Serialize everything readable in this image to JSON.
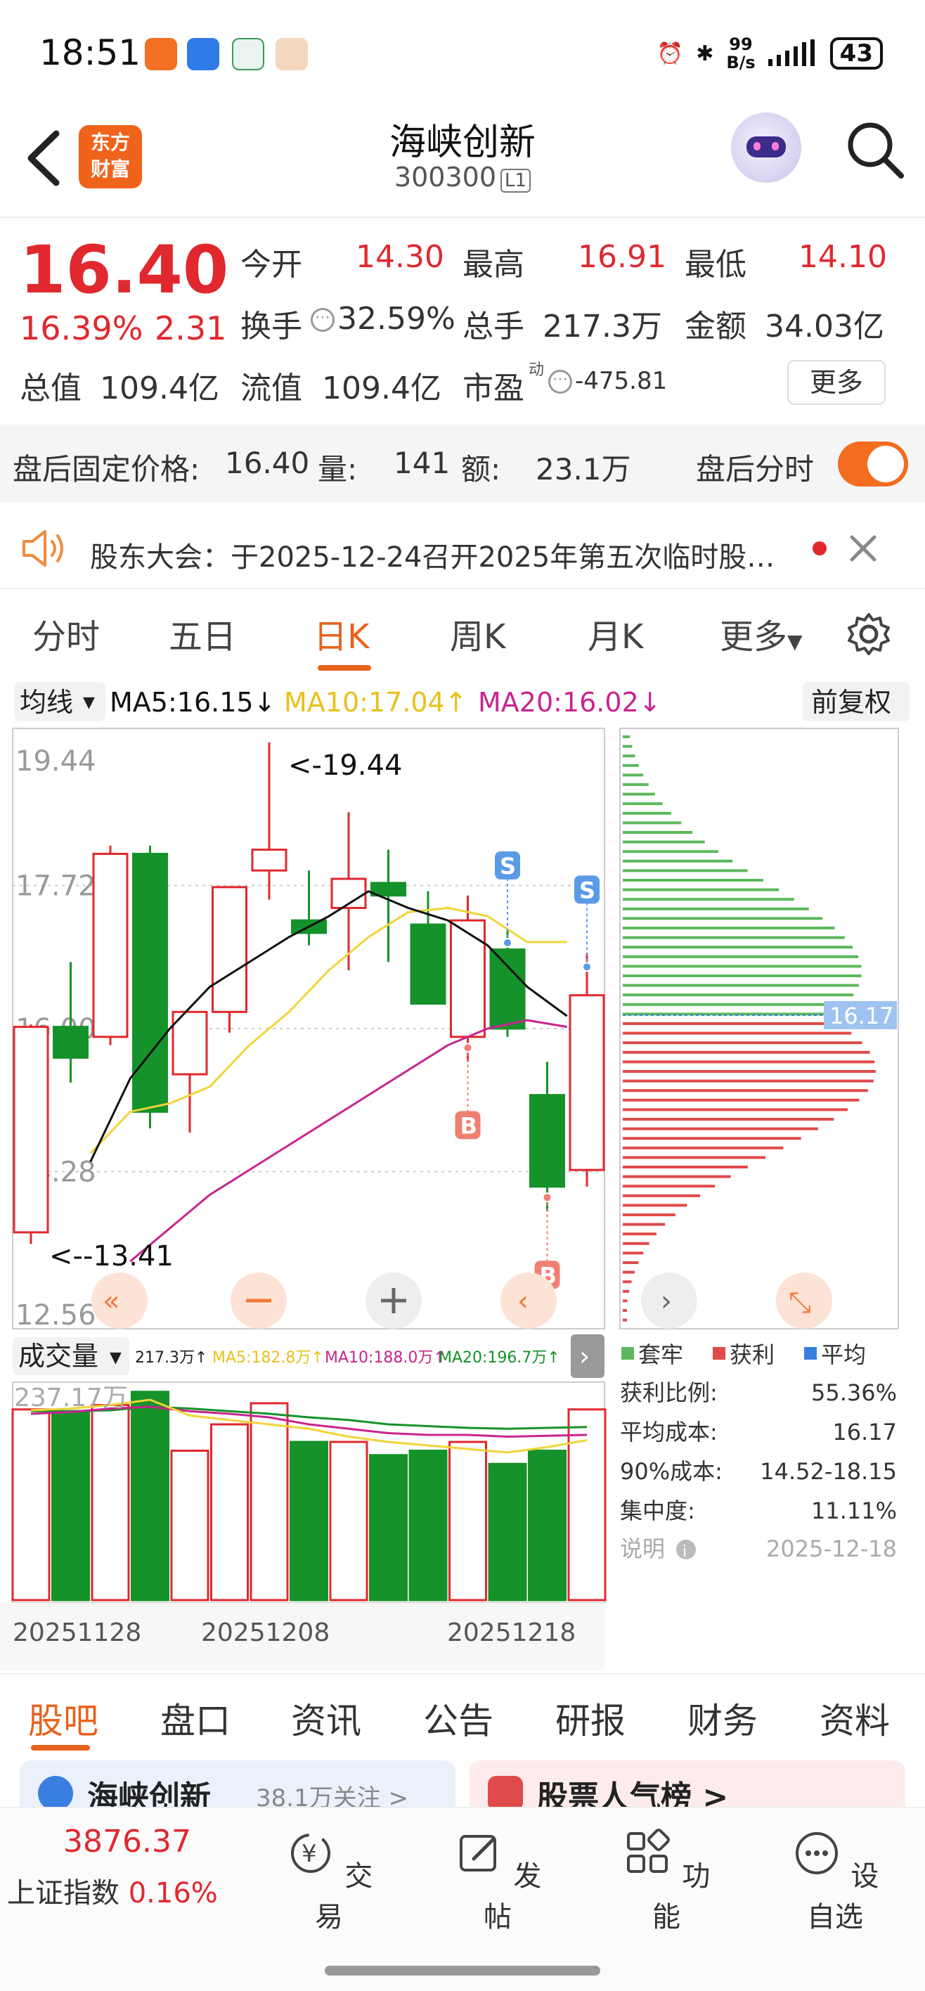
{
  "status_bar": {
    "time": "18:51",
    "net_speed_top": "99",
    "net_speed_bottom": "B/s",
    "battery": "43"
  },
  "header": {
    "logo_text": "东方财富",
    "stock_name": "海峡创新",
    "stock_code": "300300",
    "level": "L1"
  },
  "quote": {
    "price": "16.40",
    "change_pct": "16.39%",
    "change_amt": "2.31",
    "open_label": "今开",
    "open": "14.30",
    "high_label": "最高",
    "high": "16.91",
    "low_label": "最低",
    "low": "14.10",
    "turnover_label": "换手",
    "turnover": "32.59%",
    "volume_label": "总手",
    "volume": "217.3万",
    "amount_label": "金额",
    "amount": "34.03亿",
    "mktcap_label": "总值",
    "mktcap": "109.4亿",
    "float_label": "流值",
    "float": "109.4亿",
    "pe_label": "市盈",
    "pe_sup": "动",
    "pe": "-475.81",
    "more_label": "更多"
  },
  "after_hours": {
    "price_label": "盘后固定价格:",
    "price": "16.40",
    "vol_label": "量:",
    "vol": "141",
    "amt_label": "额:",
    "amt": "23.1万",
    "toggle_label": "盘后分时"
  },
  "notice": {
    "text": "股东大会：于2025-12-24召开2025年第五次临时股…"
  },
  "chart_tabs": [
    "分时",
    "五日",
    "日K",
    "周K",
    "月K",
    "更多"
  ],
  "active_chart_tab": "日K",
  "ma_bar": {
    "selector": "均线",
    "ma5": "MA5:16.15↓",
    "ma10": "MA10:17.04↑",
    "ma20": "MA20:16.02↓",
    "adjust": "前复权"
  },
  "colors": {
    "up": "#e0282e",
    "down": "#15922a",
    "ma5": "#111111",
    "ma10": "#f2d438",
    "ma20": "#c8248f",
    "accent": "#e8621c"
  },
  "chart_data": {
    "type": "candlestick",
    "y_axis_labels": [
      "19.44",
      "17.72",
      "16.00",
      "14.28",
      "12.56"
    ],
    "ylim": [
      12.56,
      19.44
    ],
    "annotations": {
      "max": "<-19.44",
      "min": "<--13.41",
      "cost_line": "16.17"
    },
    "x_ticks": [
      "20251128",
      "20251208",
      "20251218"
    ],
    "candles": [
      {
        "o": 13.55,
        "h": 16.05,
        "l": 13.41,
        "c": 16.02
      },
      {
        "o": 16.02,
        "h": 16.8,
        "l": 15.35,
        "c": 15.65
      },
      {
        "o": 15.9,
        "h": 18.2,
        "l": 15.8,
        "c": 18.1
      },
      {
        "o": 18.1,
        "h": 18.2,
        "l": 14.8,
        "c": 15.0
      },
      {
        "o": 15.45,
        "h": 16.2,
        "l": 14.75,
        "c": 16.2
      },
      {
        "o": 16.2,
        "h": 17.7,
        "l": 15.95,
        "c": 17.7
      },
      {
        "o": 17.9,
        "h": 19.44,
        "l": 17.55,
        "c": 18.15
      },
      {
        "o": 17.3,
        "h": 17.9,
        "l": 17.0,
        "c": 17.15
      },
      {
        "o": 17.45,
        "h": 18.6,
        "l": 16.7,
        "c": 17.8
      },
      {
        "o": 17.75,
        "h": 18.15,
        "l": 16.8,
        "c": 17.6
      },
      {
        "o": 17.25,
        "h": 17.65,
        "l": 16.3,
        "c": 16.3
      },
      {
        "o": 15.9,
        "h": 17.6,
        "l": 15.6,
        "c": 17.3
      },
      {
        "o": 16.95,
        "h": 17.2,
        "l": 15.9,
        "c": 16.0
      },
      {
        "o": 15.2,
        "h": 15.6,
        "l": 13.8,
        "c": 14.1
      },
      {
        "o": 14.3,
        "h": 16.91,
        "l": 14.1,
        "c": 16.4
      }
    ],
    "ma5": [
      14.4,
      15.4,
      16.0,
      16.5,
      16.8,
      17.1,
      17.35,
      17.65,
      17.45,
      17.3,
      17.0,
      16.5,
      16.15
    ],
    "ma10": [
      14.5,
      15.0,
      15.1,
      15.3,
      15.8,
      16.2,
      16.7,
      17.1,
      17.4,
      17.45,
      17.35,
      17.04,
      17.04
    ],
    "ma20": [
      13.2,
      13.6,
      14.0,
      14.3,
      14.6,
      14.9,
      15.2,
      15.5,
      15.8,
      16.0,
      16.1,
      16.02
    ],
    "signals": [
      {
        "label": "S",
        "index": 12
      },
      {
        "label": "S",
        "index": 14
      },
      {
        "label": "B",
        "index": 11
      },
      {
        "label": "B",
        "index": 13
      }
    ]
  },
  "chip": {
    "cost_label": "16.17",
    "legend": [
      "套牢",
      "获利",
      "平均"
    ],
    "rows": [
      {
        "label": "获利比例:",
        "value": "55.36%"
      },
      {
        "label": "平均成本:",
        "value": "16.17"
      },
      {
        "label": "90%成本:",
        "value": "14.52-18.15"
      },
      {
        "label": "集中度:",
        "value": "11.11%"
      }
    ],
    "note_label": "说明",
    "date": "2025-12-18",
    "colors": {
      "trapped": "#5cb85c",
      "profit": "#e04a4a",
      "avg": "#3a7fe0"
    }
  },
  "volume": {
    "selector": "成交量",
    "vol": "217.3万↑",
    "ma5": "MA5:182.8万↑",
    "ma10": "MA10:188.0万↑",
    "ma20": "MA20:196.7万↑",
    "top_label": "237.17万",
    "values": [
      217,
      215,
      222,
      237,
      170,
      200,
      224,
      180,
      180,
      165,
      170,
      180,
      155,
      170,
      217
    ]
  },
  "bottom_tabs": [
    "股吧",
    "盘口",
    "资讯",
    "公告",
    "研报",
    "财务",
    "资料"
  ],
  "active_bottom_tab": "股吧",
  "cards": {
    "left_title": "海峡创新",
    "left_sub": "38.1万关注 >",
    "right_title": "股票人气榜 >"
  },
  "index": {
    "value": "3876.37",
    "name": "上证指数",
    "change": "0.16%"
  },
  "nav": [
    {
      "label": "交易",
      "icon": "trade-icon"
    },
    {
      "label": "发帖",
      "icon": "post-icon"
    },
    {
      "label": "功能",
      "icon": "function-icon"
    },
    {
      "label": "设自选",
      "icon": "add-watchlist-icon"
    }
  ]
}
